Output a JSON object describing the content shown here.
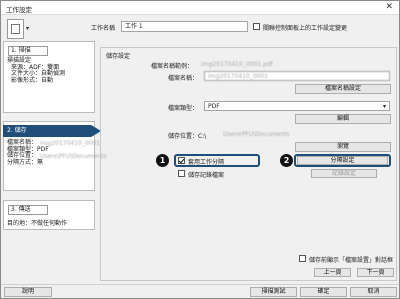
{
  "window": {
    "title": "工作設定",
    "close": "✕"
  },
  "header": {
    "name_label": "工作名稱",
    "name_value": "工作 1",
    "sync_label": "關聯控制面板上的工作設定變更"
  },
  "left": {
    "scan": {
      "title": "1. 掃描",
      "lines": [
        "掃描設定",
        "來源：ADF：雙面",
        "文件大小：自動偵測",
        "影像形式：自動"
      ]
    },
    "save": {
      "title": "2. 儲存",
      "lines": [
        "檔案名稱：",
        "檔案類型：PDF",
        "儲存位置：",
        "分隔方式：無"
      ]
    },
    "send": {
      "title": "3. 傳送",
      "lines": [
        "目的地：不做任何動作"
      ]
    }
  },
  "main": {
    "group_title": "儲存設定",
    "filename_label": "檔案名稱範例：",
    "filename_example": "img20170410_0001.pdf",
    "filename_value": "img20170410_0001",
    "prefix_label": "檔案名稱：",
    "filename_settings": "檔案名稱設定",
    "filetype_label": "檔案類型：",
    "filetype_value": "PDF",
    "edit": "編輯",
    "location_label": "儲存位置：C:\\",
    "location_value": "Users\\PFU\\Documents",
    "browse": "瀏覽",
    "use_separation": "套用工作分隔",
    "separation_settings": "分隔設定",
    "save_log": "儲存記錄檔案",
    "log_settings": "記錄設定",
    "show_after_save": "儲存前顯示「檔案設置」對話框",
    "prev": "上一頁",
    "next": "下一頁"
  },
  "callouts": {
    "one": "1",
    "two": "2"
  },
  "footer": {
    "help": "說明",
    "scan_test": "掃描測試",
    "ok": "確定",
    "cancel": "取消"
  }
}
